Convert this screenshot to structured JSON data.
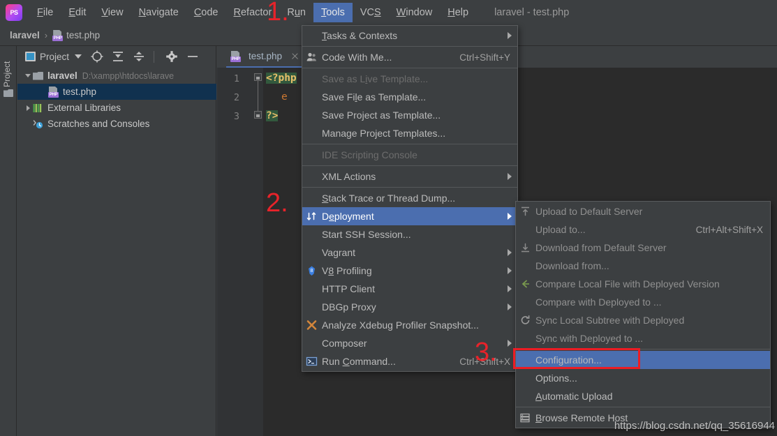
{
  "app": {
    "logo": "phpstorm-logo",
    "window_title": "laravel - test.php",
    "accent_blue": "#4b6eaf",
    "annotation_red": "#ec1c24",
    "background": "#3c3f41"
  },
  "menubar": {
    "items": [
      {
        "label": "File",
        "mnemonic": "F",
        "active": false
      },
      {
        "label": "Edit",
        "mnemonic": "E",
        "active": false
      },
      {
        "label": "View",
        "mnemonic": "V",
        "active": false
      },
      {
        "label": "Navigate",
        "mnemonic": "N",
        "active": false
      },
      {
        "label": "Code",
        "mnemonic": "C",
        "active": false
      },
      {
        "label": "Refactor",
        "mnemonic": "R",
        "active": false
      },
      {
        "label": "Run",
        "mnemonic": "u",
        "active": false
      },
      {
        "label": "Tools",
        "mnemonic": "T",
        "active": true
      },
      {
        "label": "VCS",
        "mnemonic": "S",
        "active": false
      },
      {
        "label": "Window",
        "mnemonic": "W",
        "active": false
      },
      {
        "label": "Help",
        "mnemonic": "H",
        "active": false
      }
    ]
  },
  "breadcrumb": {
    "project": "laravel",
    "separator": "›",
    "file": "test.php"
  },
  "tool_strip": {
    "label": "Project"
  },
  "project_panel": {
    "toolbar": {
      "title": "Project",
      "icons": [
        "project-select-icon",
        "locate-icon",
        "expand-all-icon",
        "collapse-all-icon",
        "settings-gear-icon",
        "hide-icon"
      ]
    },
    "tree": [
      {
        "label": "laravel",
        "path": "D:\\xampp\\htdocs\\larave",
        "icon": "folder-icon",
        "expanded": true,
        "selected": false,
        "indent": 0,
        "bold": true
      },
      {
        "label": "test.php",
        "path": "",
        "icon": "php-file-icon",
        "expanded": null,
        "selected": true,
        "indent": 1,
        "bold": false
      },
      {
        "label": "External Libraries",
        "path": "",
        "icon": "libraries-icon",
        "expanded": false,
        "selected": false,
        "indent": 0,
        "bold": false
      },
      {
        "label": "Scratches and Consoles",
        "path": "",
        "icon": "scratches-icon",
        "expanded": null,
        "selected": false,
        "indent": 0,
        "bold": false
      }
    ]
  },
  "editor": {
    "tab": {
      "label": "test.php",
      "icon": "php-file-icon",
      "close": "close-icon"
    },
    "line_numbers": [
      "1",
      "2",
      "3"
    ],
    "code_lines": [
      {
        "text": "<?php",
        "token": "php-open-tag"
      },
      {
        "text": "e",
        "token": "identifier"
      },
      {
        "text": "?>",
        "token": "php-close-tag"
      }
    ]
  },
  "tools_menu": {
    "items": [
      {
        "label": "Tasks & Contexts",
        "mnemonic": "T",
        "shortcut": "",
        "icon": "",
        "submenu": true,
        "disabled": false,
        "highlight": false,
        "separator_after": true
      },
      {
        "label": "Code With Me...",
        "mnemonic": "",
        "shortcut": "Ctrl+Shift+Y",
        "icon": "people-icon",
        "submenu": false,
        "disabled": false,
        "highlight": false,
        "separator_after": true
      },
      {
        "label": "Save as Live Template...",
        "mnemonic": "i",
        "shortcut": "",
        "icon": "",
        "submenu": false,
        "disabled": true,
        "highlight": false,
        "separator_after": false
      },
      {
        "label": "Save File as Template...",
        "mnemonic": "l",
        "shortcut": "",
        "icon": "",
        "submenu": false,
        "disabled": false,
        "highlight": false,
        "separator_after": false
      },
      {
        "label": "Save Project as Template...",
        "mnemonic": "",
        "shortcut": "",
        "icon": "",
        "submenu": false,
        "disabled": false,
        "highlight": false,
        "separator_after": false
      },
      {
        "label": "Manage Project Templates...",
        "mnemonic": "",
        "shortcut": "",
        "icon": "",
        "submenu": false,
        "disabled": false,
        "highlight": false,
        "separator_after": true
      },
      {
        "label": "IDE Scripting Console",
        "mnemonic": "",
        "shortcut": "",
        "icon": "",
        "submenu": false,
        "disabled": true,
        "highlight": false,
        "separator_after": true
      },
      {
        "label": "XML Actions",
        "mnemonic": "",
        "shortcut": "",
        "icon": "",
        "submenu": true,
        "disabled": false,
        "highlight": false,
        "separator_after": true
      },
      {
        "label": "Stack Trace or Thread Dump...",
        "mnemonic": "S",
        "shortcut": "",
        "icon": "",
        "submenu": false,
        "disabled": false,
        "highlight": false,
        "separator_after": false
      },
      {
        "label": "Deployment",
        "mnemonic": "e",
        "shortcut": "",
        "icon": "deployment-icon",
        "submenu": true,
        "disabled": false,
        "highlight": true,
        "separator_after": false
      },
      {
        "label": "Start SSH Session...",
        "mnemonic": "",
        "shortcut": "",
        "icon": "",
        "submenu": false,
        "disabled": false,
        "highlight": false,
        "separator_after": false
      },
      {
        "label": "Vagrant",
        "mnemonic": "",
        "shortcut": "",
        "icon": "",
        "submenu": true,
        "disabled": false,
        "highlight": false,
        "separator_after": false
      },
      {
        "label": "V8 Profiling",
        "mnemonic": "8",
        "shortcut": "",
        "icon": "v8-icon",
        "submenu": true,
        "disabled": false,
        "highlight": false,
        "separator_after": false
      },
      {
        "label": "HTTP Client",
        "mnemonic": "",
        "shortcut": "",
        "icon": "",
        "submenu": true,
        "disabled": false,
        "highlight": false,
        "separator_after": false
      },
      {
        "label": "DBGp Proxy",
        "mnemonic": "",
        "shortcut": "",
        "icon": "",
        "submenu": true,
        "disabled": false,
        "highlight": false,
        "separator_after": false
      },
      {
        "label": "Analyze Xdebug Profiler Snapshot...",
        "mnemonic": "",
        "shortcut": "",
        "icon": "xdebug-icon",
        "submenu": false,
        "disabled": false,
        "highlight": false,
        "separator_after": false
      },
      {
        "label": "Composer",
        "mnemonic": "",
        "shortcut": "",
        "icon": "",
        "submenu": true,
        "disabled": false,
        "highlight": false,
        "separator_after": false
      },
      {
        "label": "Run Command...",
        "mnemonic": "C",
        "shortcut": "Ctrl+Shift+X",
        "icon": "terminal-icon",
        "submenu": false,
        "disabled": false,
        "highlight": false,
        "separator_after": false
      }
    ]
  },
  "deployment_menu": {
    "items": [
      {
        "label": "Upload to Default Server",
        "mnemonic": "",
        "shortcut": "",
        "icon": "upload-icon",
        "disabled": true,
        "highlight": false,
        "separator_after": false
      },
      {
        "label": "Upload to...",
        "mnemonic": "",
        "shortcut": "Ctrl+Alt+Shift+X",
        "icon": "",
        "disabled": true,
        "highlight": false,
        "separator_after": false
      },
      {
        "label": "Download from Default Server",
        "mnemonic": "",
        "shortcut": "",
        "icon": "download-icon",
        "disabled": true,
        "highlight": false,
        "separator_after": false
      },
      {
        "label": "Download from...",
        "mnemonic": "",
        "shortcut": "",
        "icon": "",
        "disabled": true,
        "highlight": false,
        "separator_after": false
      },
      {
        "label": "Compare Local File with Deployed Version",
        "mnemonic": "",
        "shortcut": "",
        "icon": "compare-icon",
        "disabled": true,
        "highlight": false,
        "separator_after": false
      },
      {
        "label": "Compare with Deployed to ...",
        "mnemonic": "",
        "shortcut": "",
        "icon": "",
        "disabled": true,
        "highlight": false,
        "separator_after": false
      },
      {
        "label": "Sync Local Subtree with Deployed",
        "mnemonic": "",
        "shortcut": "",
        "icon": "sync-icon",
        "disabled": true,
        "highlight": false,
        "separator_after": false
      },
      {
        "label": "Sync with Deployed to ...",
        "mnemonic": "",
        "shortcut": "",
        "icon": "",
        "disabled": true,
        "highlight": false,
        "separator_after": true
      },
      {
        "label": "Configuration...",
        "mnemonic": "",
        "shortcut": "",
        "icon": "",
        "disabled": false,
        "highlight": true,
        "separator_after": false
      },
      {
        "label": "Options...",
        "mnemonic": "",
        "shortcut": "",
        "icon": "",
        "disabled": false,
        "highlight": false,
        "separator_after": false
      },
      {
        "label": "Automatic Upload",
        "mnemonic": "A",
        "shortcut": "",
        "icon": "",
        "disabled": false,
        "highlight": false,
        "separator_after": true
      },
      {
        "label": "Browse Remote Host",
        "mnemonic": "B",
        "shortcut": "",
        "icon": "remote-host-icon",
        "disabled": false,
        "highlight": false,
        "separator_after": false
      }
    ]
  },
  "annotations": [
    {
      "label": "1.",
      "target": "tools-menubar-item"
    },
    {
      "label": "2.",
      "target": "deployment-menu-item"
    },
    {
      "label": "3.",
      "target": "configuration-menu-item"
    }
  ],
  "watermark": {
    "text": "https://blog.csdn.net/qq_35616944"
  }
}
